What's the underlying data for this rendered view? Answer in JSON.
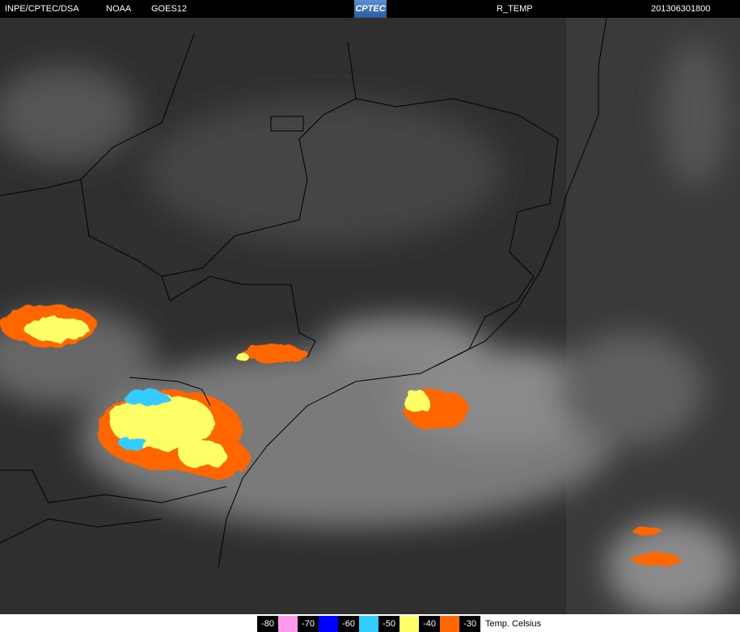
{
  "header": {
    "source": "INPE/CPTEC/DSA",
    "agency": "NOAA",
    "satellite": "GOES12",
    "logo": "CPTEC",
    "product": "R_TEMP",
    "datetime": "201306301800"
  },
  "legend": {
    "items": [
      {
        "label": "-80",
        "color": "#ff99ee"
      },
      {
        "label": "-70",
        "color": "#0000ff"
      },
      {
        "label": "-60",
        "color": "#33ccff"
      },
      {
        "label": "-50",
        "color": "#ffff66"
      },
      {
        "label": "-40",
        "color": "#ff6600"
      },
      {
        "label": "-30",
        "color": null
      }
    ],
    "unit": "Temp. Celsius"
  }
}
